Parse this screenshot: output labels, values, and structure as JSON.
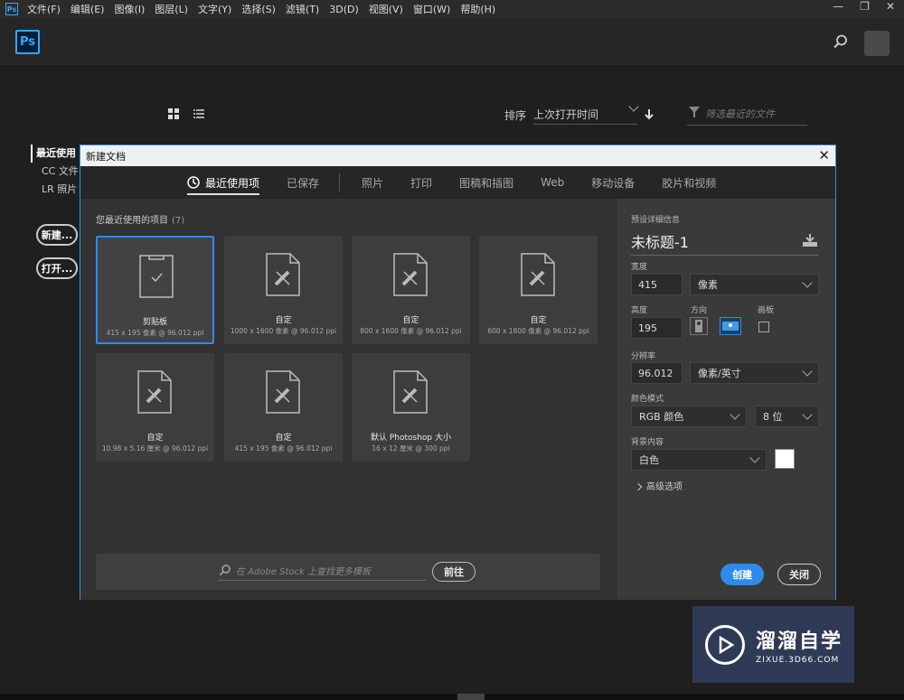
{
  "menubar": {
    "logo": "Ps",
    "items": [
      "文件(F)",
      "编辑(E)",
      "图像(I)",
      "图层(L)",
      "文字(Y)",
      "选择(S)",
      "滤镜(T)",
      "3D(D)",
      "视图(V)",
      "窗口(W)",
      "帮助(H)"
    ],
    "win_min": "—",
    "win_max": "❐",
    "win_close": "✕"
  },
  "app": {
    "logo": "Ps"
  },
  "home": {
    "sort_label": "排序",
    "sort_value": "上次打开时间",
    "filter_placeholder": "筛选最近的文件",
    "left_items": [
      "最近使用",
      "CC 文件",
      "LR 照片"
    ],
    "new_btn": "新建...",
    "open_btn": "打开..."
  },
  "dialog": {
    "title": "新建文档",
    "close": "✕",
    "tabs": [
      "最近使用项",
      "已保存",
      "照片",
      "打印",
      "图稿和插图",
      "Web",
      "移动设备",
      "胶片和视频"
    ],
    "recent_label": "您最近使用的项目",
    "recent_count": "(7)",
    "cards": [
      {
        "name": "剪贴板",
        "dims": "415 x 195 像素 @ 96.012 ppi",
        "icon": "clipboard-icon"
      },
      {
        "name": "自定",
        "dims": "1000 x 1600 像素 @ 96.012 ppi",
        "icon": "custom-doc-icon"
      },
      {
        "name": "自定",
        "dims": "800 x 1600 像素 @ 96.012 ppi",
        "icon": "custom-doc-icon"
      },
      {
        "name": "自定",
        "dims": "600 x 1800 像素 @ 96.012 ppi",
        "icon": "custom-doc-icon"
      },
      {
        "name": "自定",
        "dims": "10.98 x 5.16 厘米 @ 96.012 ppi",
        "icon": "custom-doc-icon"
      },
      {
        "name": "自定",
        "dims": "415 x 195 像素 @ 96.012 ppi",
        "icon": "custom-doc-icon"
      },
      {
        "name": "默认 Photoshop 大小",
        "dims": "16 x 12 厘米 @ 300 ppi",
        "icon": "custom-doc-icon"
      }
    ],
    "stock_placeholder": "在 Adobe Stock 上查找更多模板",
    "go_btn": "前往",
    "preset": {
      "section": "预设详细信息",
      "doc_name": "未标题-1",
      "width_label": "宽度",
      "width_value": "415",
      "width_unit": "像素",
      "height_label": "高度",
      "height_value": "195",
      "orientation_label": "方向",
      "artboard_label": "画板",
      "resolution_label": "分辨率",
      "resolution_value": "96.012",
      "resolution_unit": "像素/英寸",
      "color_mode_label": "颜色模式",
      "color_mode_value": "RGB 颜色",
      "bit_depth": "8 位",
      "bg_label": "背景内容",
      "bg_value": "白色",
      "bg_color": "#ffffff",
      "advanced": "高级选项",
      "create_btn": "创建",
      "close_btn": "关闭"
    }
  },
  "watermark": {
    "big": "溜溜自学",
    "small": "ZIXUE.3D66.COM"
  },
  "colors": {
    "accent": "#2d8ceb",
    "ps_blue": "#31a8ff"
  }
}
